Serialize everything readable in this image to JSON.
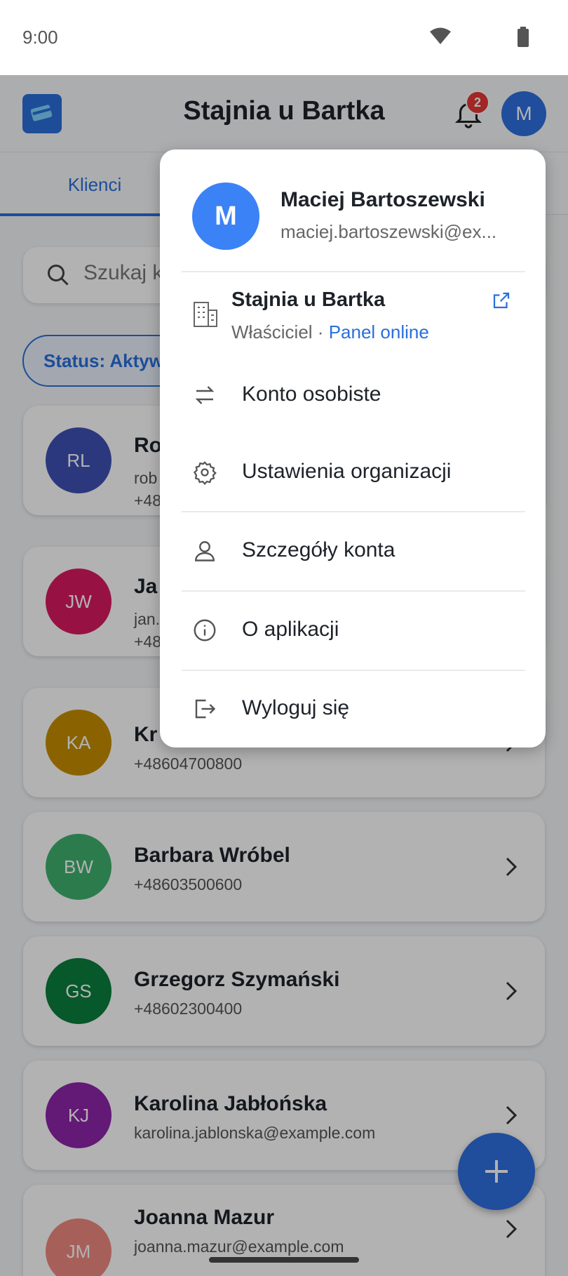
{
  "status_bar": {
    "time": "9:00"
  },
  "app": {
    "title": "Stajnia u Bartka",
    "notification_count": "2",
    "user_initial": "M"
  },
  "tabs": [
    {
      "label": "Klienci"
    }
  ],
  "search": {
    "placeholder": "Szukaj k"
  },
  "filter": {
    "chip_label": "Status: Aktyw"
  },
  "clients": [
    {
      "initials": "RL",
      "name": "Ro",
      "line1": "rob",
      "line2": "+48",
      "color": "#3f51b5"
    },
    {
      "initials": "JW",
      "name": "Ja",
      "line1": "jan.",
      "line2": "+48",
      "color": "#d81b60"
    },
    {
      "initials": "KA",
      "name": "Kr",
      "line1": "+48604700800",
      "color": "#c68f00"
    },
    {
      "initials": "BW",
      "name": "Barbara Wróbel",
      "line1": "+48603500600",
      "color": "#3fb06f"
    },
    {
      "initials": "GS",
      "name": "Grzegorz Szymański",
      "line1": "+48602300400",
      "color": "#0b7f3d"
    },
    {
      "initials": "KJ",
      "name": "Karolina Jabłońska",
      "line1": "karolina.jablonska@example.com",
      "color": "#8e24aa"
    },
    {
      "initials": "JM",
      "name": "Joanna Mazur",
      "line1": "joanna.mazur@example.com",
      "color": "#ef8a80"
    }
  ],
  "menu": {
    "user_initial": "M",
    "user_name": "Maciej Bartoszewski",
    "user_email": "maciej.bartoszewski@ex...",
    "org_name": "Stajnia u Bartka",
    "org_role": "Właściciel",
    "org_separator": " · ",
    "org_link": "Panel online",
    "items": [
      {
        "label": "Konto osobiste",
        "icon": "swap-icon"
      },
      {
        "label": "Ustawienia organizacji",
        "icon": "gear-icon"
      },
      {
        "label": "Szczegóły konta",
        "icon": "person-icon"
      },
      {
        "label": "O aplikacji",
        "icon": "info-icon"
      },
      {
        "label": "Wyloguj się",
        "icon": "logout-icon"
      }
    ]
  }
}
